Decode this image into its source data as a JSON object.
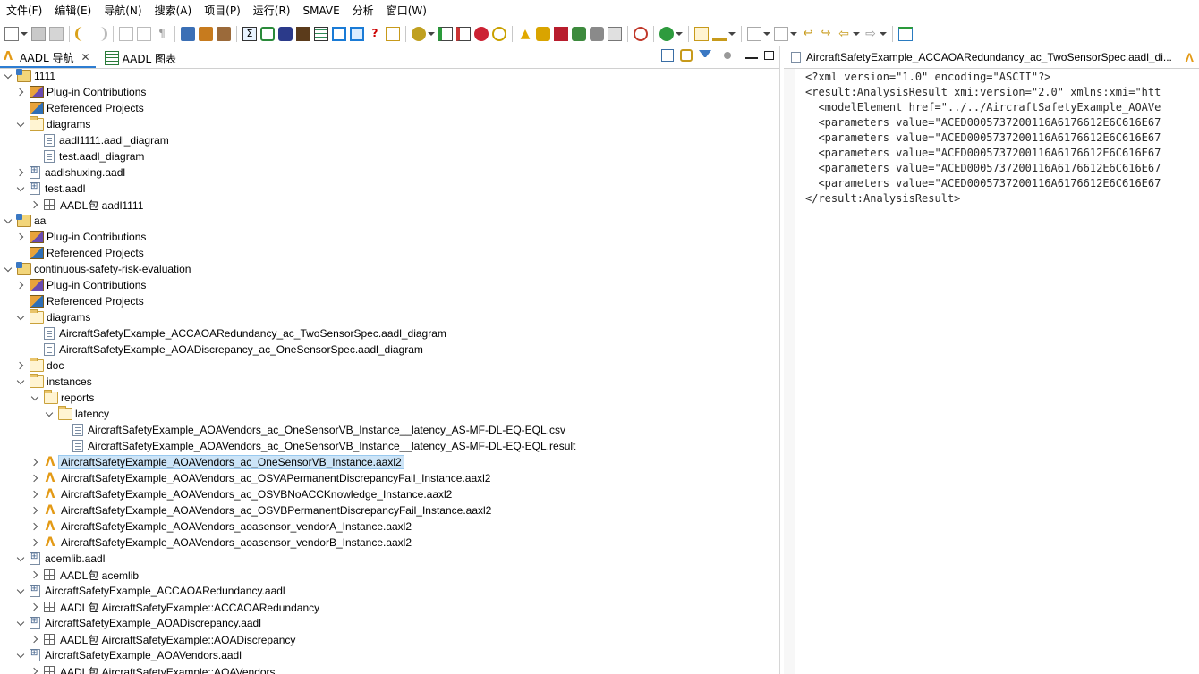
{
  "menu": [
    "文件(F)",
    "编辑(E)",
    "导航(N)",
    "搜索(A)",
    "项目(P)",
    "运行(R)",
    "SMAVE",
    "分析",
    "窗口(W)"
  ],
  "left_tabs": [
    {
      "label": "AADL 导航",
      "icon": "aadl-logo-icon"
    },
    {
      "label": "AADL 图表",
      "icon": "diagram-icon"
    }
  ],
  "tree": [
    {
      "label": "1111",
      "icon": "project",
      "depth": 0,
      "state": "expanded"
    },
    {
      "label": "Plug-in Contributions",
      "icon": "plugin",
      "depth": 1,
      "state": "collapsed"
    },
    {
      "label": "Referenced Projects",
      "icon": "refs",
      "depth": 1,
      "state": "leaf"
    },
    {
      "label": "diagrams",
      "icon": "folder",
      "depth": 1,
      "state": "expanded"
    },
    {
      "label": "aadl1111.aadl_diagram",
      "icon": "file",
      "depth": 2,
      "state": "leaf"
    },
    {
      "label": "test.aadl_diagram",
      "icon": "file",
      "depth": 2,
      "state": "leaf"
    },
    {
      "label": "aadlshuxing.aadl",
      "icon": "aadl",
      "depth": 1,
      "state": "collapsed"
    },
    {
      "label": "test.aadl",
      "icon": "aadl",
      "depth": 1,
      "state": "expanded"
    },
    {
      "label": "AADL包 aadl1111",
      "icon": "pkg",
      "depth": 2,
      "state": "collapsed"
    },
    {
      "label": "aa",
      "icon": "project",
      "depth": 0,
      "state": "expanded"
    },
    {
      "label": "Plug-in Contributions",
      "icon": "plugin",
      "depth": 1,
      "state": "collapsed"
    },
    {
      "label": "Referenced Projects",
      "icon": "refs",
      "depth": 1,
      "state": "leaf"
    },
    {
      "label": "continuous-safety-risk-evaluation",
      "icon": "project",
      "depth": 0,
      "state": "expanded"
    },
    {
      "label": "Plug-in Contributions",
      "icon": "plugin",
      "depth": 1,
      "state": "collapsed"
    },
    {
      "label": "Referenced Projects",
      "icon": "refs",
      "depth": 1,
      "state": "leaf"
    },
    {
      "label": "diagrams",
      "icon": "folder",
      "depth": 1,
      "state": "expanded"
    },
    {
      "label": "AircraftSafetyExample_ACCAOARedundancy_ac_TwoSensorSpec.aadl_diagram",
      "icon": "file",
      "depth": 2,
      "state": "leaf"
    },
    {
      "label": "AircraftSafetyExample_AOADiscrepancy_ac_OneSensorSpec.aadl_diagram",
      "icon": "file",
      "depth": 2,
      "state": "leaf"
    },
    {
      "label": "doc",
      "icon": "folder",
      "depth": 1,
      "state": "collapsed"
    },
    {
      "label": "instances",
      "icon": "folder",
      "depth": 1,
      "state": "expanded"
    },
    {
      "label": "reports",
      "icon": "folder",
      "depth": 2,
      "state": "expanded"
    },
    {
      "label": "latency",
      "icon": "folder",
      "depth": 3,
      "state": "expanded"
    },
    {
      "label": "AircraftSafetyExample_AOAVendors_ac_OneSensorVB_Instance__latency_AS-MF-DL-EQ-EQL.csv",
      "icon": "file",
      "depth": 4,
      "state": "leaf"
    },
    {
      "label": "AircraftSafetyExample_AOAVendors_ac_OneSensorVB_Instance__latency_AS-MF-DL-EQ-EQL.result",
      "icon": "file",
      "depth": 4,
      "state": "leaf"
    },
    {
      "label": "AircraftSafetyExample_AOAVendors_ac_OneSensorVB_Instance.aaxl2",
      "icon": "inst",
      "depth": 2,
      "state": "collapsed",
      "selected": true
    },
    {
      "label": "AircraftSafetyExample_AOAVendors_ac_OSVAPermanentDiscrepancyFail_Instance.aaxl2",
      "icon": "inst",
      "depth": 2,
      "state": "collapsed"
    },
    {
      "label": "AircraftSafetyExample_AOAVendors_ac_OSVBNoACCKnowledge_Instance.aaxl2",
      "icon": "inst",
      "depth": 2,
      "state": "collapsed"
    },
    {
      "label": "AircraftSafetyExample_AOAVendors_ac_OSVBPermanentDiscrepancyFail_Instance.aaxl2",
      "icon": "inst",
      "depth": 2,
      "state": "collapsed"
    },
    {
      "label": "AircraftSafetyExample_AOAVendors_aoasensor_vendorA_Instance.aaxl2",
      "icon": "inst",
      "depth": 2,
      "state": "collapsed"
    },
    {
      "label": "AircraftSafetyExample_AOAVendors_aoasensor_vendorB_Instance.aaxl2",
      "icon": "inst",
      "depth": 2,
      "state": "collapsed"
    },
    {
      "label": "acemlib.aadl",
      "icon": "aadl",
      "depth": 1,
      "state": "expanded"
    },
    {
      "label": "AADL包 acemlib",
      "icon": "pkg",
      "depth": 2,
      "state": "collapsed"
    },
    {
      "label": "AircraftSafetyExample_ACCAOARedundancy.aadl",
      "icon": "aadl",
      "depth": 1,
      "state": "expanded"
    },
    {
      "label": "AADL包 AircraftSafetyExample::ACCAOARedundancy",
      "icon": "pkg",
      "depth": 2,
      "state": "collapsed"
    },
    {
      "label": "AircraftSafetyExample_AOADiscrepancy.aadl",
      "icon": "aadl",
      "depth": 1,
      "state": "expanded"
    },
    {
      "label": "AADL包 AircraftSafetyExample::AOADiscrepancy",
      "icon": "pkg",
      "depth": 2,
      "state": "collapsed"
    },
    {
      "label": "AircraftSafetyExample_AOAVendors.aadl",
      "icon": "aadl",
      "depth": 1,
      "state": "expanded"
    },
    {
      "label": "AADL包 AircraftSafetyExample::AOAVendors",
      "icon": "pkg",
      "depth": 2,
      "state": "collapsed"
    }
  ],
  "editor": {
    "tab_title": "AircraftSafetyExample_ACCAOARedundancy_ac_TwoSensorSpec.aadl_di...",
    "lines": [
      "<?xml version=\"1.0\" encoding=\"ASCII\"?>",
      "<result:AnalysisResult xmi:version=\"2.0\" xmlns:xmi=\"htt",
      "  <modelElement href=\"../../AircraftSafetyExample_AOAVe",
      "  <parameters value=\"ACED0005737200116A6176612E6C616E67",
      "  <parameters value=\"ACED0005737200116A6176612E6C616E67",
      "  <parameters value=\"ACED0005737200116A6176612E6C616E67",
      "  <parameters value=\"ACED0005737200116A6176612E6C616E67",
      "  <parameters value=\"ACED0005737200116A6176612E6C616E67",
      "</result:AnalysisResult>"
    ]
  },
  "colors": {
    "selection": "#cce4f7",
    "accent_tab": "#2d7dd2",
    "instance_icon": "#e39a16"
  }
}
